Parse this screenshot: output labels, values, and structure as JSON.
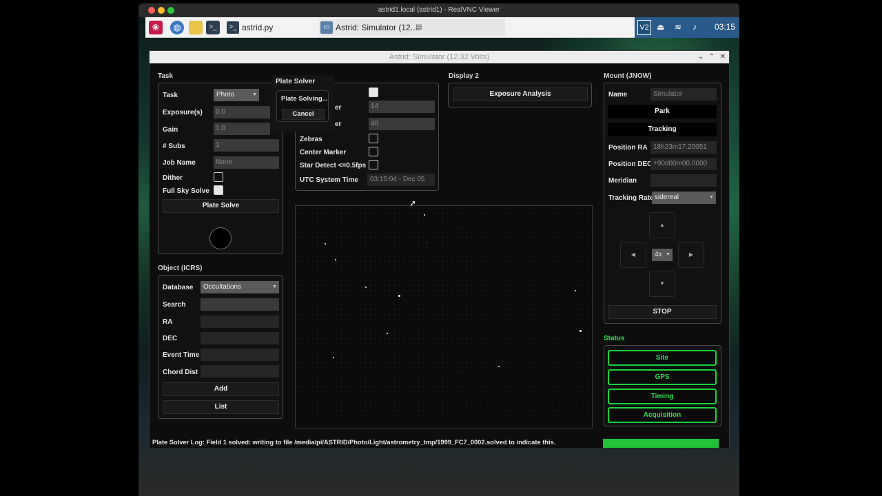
{
  "vnc": {
    "title": "astrid1.local (astrid1) - RealVNC Viewer"
  },
  "taskbar": {
    "items": [
      {
        "label": "astrid.py",
        "icon": "terminal-icon"
      },
      {
        "label": "Astrid: Simulator (12....",
        "icon": "window-icon"
      }
    ],
    "clock": "03:15",
    "vnc_badge": "V2"
  },
  "app": {
    "title": "Astrid: Simulator (12.32 Volts)",
    "task": {
      "section": "Task",
      "task_label": "Task",
      "task_value": "Photo",
      "exposure_label": "Exposure(s)",
      "exposure_value": "0.0",
      "gain_label": "Gain",
      "gain_value": "1.0",
      "subs_label": "# Subs",
      "subs_value": "1",
      "job_label": "Job Name",
      "job_placeholder": "None",
      "dither_label": "Dither",
      "fullsky_label": "Full Sky Solve",
      "plate_solve_button": "Plate Solve"
    },
    "plate_solver": {
      "title": "Plate Solver",
      "status": "Plate Solving...",
      "cancel": "Cancel"
    },
    "display": {
      "row1_value": "14",
      "row2_value": "40",
      "row1_label_tail": "er",
      "row2_label_tail": "er",
      "zebras_label": "Zebras",
      "center_label": "Center Marker",
      "star_detect_label": "Star Detect <=0.5fps",
      "utc_label": "UTC System Time",
      "utc_value": "03:15:04 - Dec 05"
    },
    "display2": {
      "section": "Display 2",
      "exposure_analysis": "Exposure Analysis"
    },
    "object": {
      "section": "Object (ICRS)",
      "database_label": "Database",
      "database_value": "Occultations",
      "search_label": "Search",
      "ra_label": "RA",
      "dec_label": "DEC",
      "event_label": "Event Time",
      "chord_label": "Chord Dist",
      "add_button": "Add",
      "list_button": "List"
    },
    "mount": {
      "section": "Mount (JNOW)",
      "name_label": "Name",
      "name_value": "Simulator",
      "park_button": "Park",
      "tracking_button": "Tracking",
      "pos_ra_label": "Position RA",
      "pos_ra_value": "18h23m17.20051",
      "pos_dec_label": "Position DEC",
      "pos_dec_value": "+90d00m00.0000",
      "meridian_label": "Meridian",
      "meridian_value": "",
      "tracking_rate_label": "Tracking Rate",
      "tracking_rate_value": "sidereal",
      "speed_value": "4x",
      "stop_button": "STOP"
    },
    "status": {
      "section": "Status",
      "buttons": [
        "Site",
        "GPS",
        "Timing",
        "Acquisition"
      ],
      "accent": "#19d43c"
    },
    "log": "Plate Solver Log: Field 1 solved: writing to file /media/pi/ASTRID/Photo/Light/astrometry_tmp/1999_FC7_0002.solved to indicate this."
  }
}
